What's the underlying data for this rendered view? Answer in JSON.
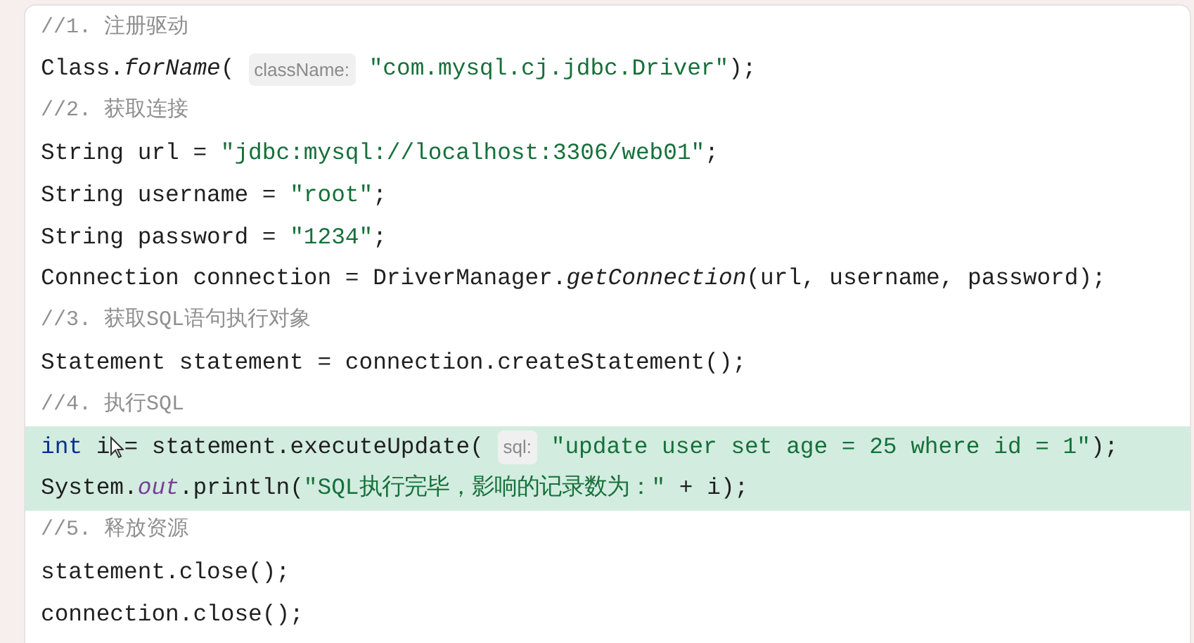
{
  "code_lines": [
    {
      "highlighted": false,
      "tokens": [
        {
          "kind": "comment",
          "text": "//1. 注册驱动"
        }
      ]
    },
    {
      "highlighted": false,
      "tokens": [
        {
          "kind": "plain",
          "text": "Class."
        },
        {
          "kind": "italic",
          "text": "forName"
        },
        {
          "kind": "plain",
          "text": "( "
        },
        {
          "kind": "hint",
          "text": "className:"
        },
        {
          "kind": "string",
          "text": " \"com.mysql.cj.jdbc.Driver\""
        },
        {
          "kind": "plain",
          "text": ");"
        }
      ]
    },
    {
      "highlighted": false,
      "tokens": [
        {
          "kind": "comment",
          "text": "//2. 获取连接"
        }
      ]
    },
    {
      "highlighted": false,
      "tokens": [
        {
          "kind": "plain",
          "text": "String url = "
        },
        {
          "kind": "string",
          "text": "\"jdbc:mysql://localhost:3306/web01\""
        },
        {
          "kind": "plain",
          "text": ";"
        }
      ]
    },
    {
      "highlighted": false,
      "tokens": [
        {
          "kind": "plain",
          "text": "String username = "
        },
        {
          "kind": "string",
          "text": "\"root\""
        },
        {
          "kind": "plain",
          "text": ";"
        }
      ]
    },
    {
      "highlighted": false,
      "tokens": [
        {
          "kind": "plain",
          "text": "String password = "
        },
        {
          "kind": "string",
          "text": "\"1234\""
        },
        {
          "kind": "plain",
          "text": ";"
        }
      ]
    },
    {
      "highlighted": false,
      "tokens": [
        {
          "kind": "plain",
          "text": "Connection connection = DriverManager."
        },
        {
          "kind": "italic",
          "text": "getConnection"
        },
        {
          "kind": "plain",
          "text": "(url, username, password);"
        }
      ]
    },
    {
      "highlighted": false,
      "tokens": [
        {
          "kind": "comment",
          "text": "//3. 获取SQL语句执行对象"
        }
      ]
    },
    {
      "highlighted": false,
      "tokens": [
        {
          "kind": "plain",
          "text": "Statement statement = connection.createStatement();"
        }
      ]
    },
    {
      "highlighted": false,
      "tokens": [
        {
          "kind": "comment",
          "text": "//4. 执行SQL"
        }
      ]
    },
    {
      "highlighted": true,
      "tokens": [
        {
          "kind": "keyword",
          "text": "int"
        },
        {
          "kind": "plain",
          "text": " i"
        },
        {
          "kind": "pointer"
        },
        {
          "kind": "plain",
          "text": "= statement.executeUpdate( "
        },
        {
          "kind": "hint",
          "text": "sql:"
        },
        {
          "kind": "string",
          "text": " \"update user set age = 25 where id = 1\""
        },
        {
          "kind": "plain",
          "text": ");"
        }
      ]
    },
    {
      "highlighted": true,
      "tokens": [
        {
          "kind": "plain",
          "text": "System."
        },
        {
          "kind": "italic_field",
          "text": "out"
        },
        {
          "kind": "plain",
          "text": ".println("
        },
        {
          "kind": "string",
          "text": "\"SQL执行完毕，影响的记录数为：\""
        },
        {
          "kind": "plain",
          "text": " + i);"
        }
      ]
    },
    {
      "highlighted": false,
      "tokens": [
        {
          "kind": "comment",
          "text": "//5. 释放资源"
        }
      ]
    },
    {
      "highlighted": false,
      "tokens": [
        {
          "kind": "plain",
          "text": "statement.close();"
        }
      ]
    },
    {
      "highlighted": false,
      "tokens": [
        {
          "kind": "plain",
          "text": "connection.close();"
        }
      ]
    }
  ]
}
